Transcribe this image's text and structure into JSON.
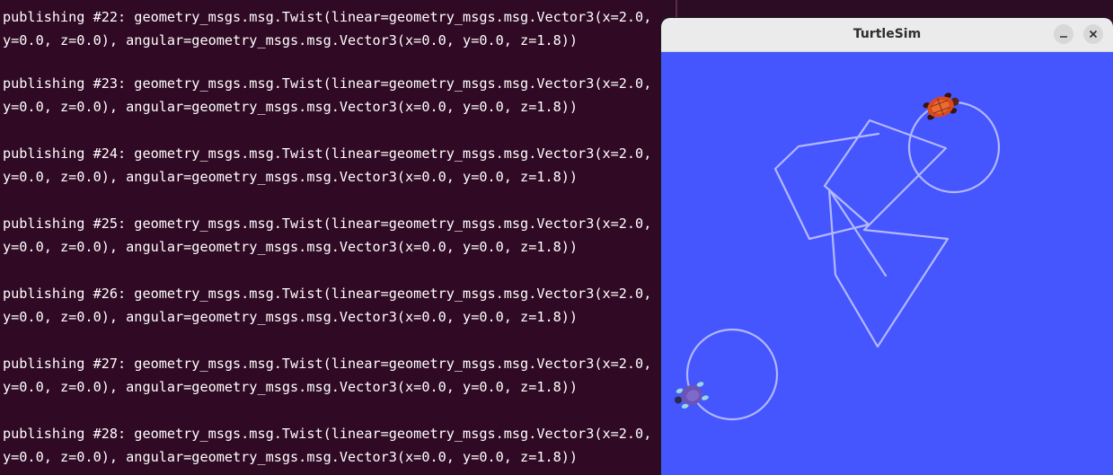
{
  "terminal": {
    "entries": [
      {
        "line1": "publishing #22: geometry_msgs.msg.Twist(linear=geometry_msgs.msg.Vector3(x=2.0,",
        "line2": "y=0.0, z=0.0), angular=geometry_msgs.msg.Vector3(x=0.0, y=0.0, z=1.8))"
      },
      {
        "line1": "publishing #23: geometry_msgs.msg.Twist(linear=geometry_msgs.msg.Vector3(x=2.0,",
        "line2": "y=0.0, z=0.0), angular=geometry_msgs.msg.Vector3(x=0.0, y=0.0, z=1.8))"
      },
      {
        "line1": "publishing #24: geometry_msgs.msg.Twist(linear=geometry_msgs.msg.Vector3(x=2.0,",
        "line2": "y=0.0, z=0.0), angular=geometry_msgs.msg.Vector3(x=0.0, y=0.0, z=1.8))"
      },
      {
        "line1": "publishing #25: geometry_msgs.msg.Twist(linear=geometry_msgs.msg.Vector3(x=2.0,",
        "line2": "y=0.0, z=0.0), angular=geometry_msgs.msg.Vector3(x=0.0, y=0.0, z=1.8))"
      },
      {
        "line1": "publishing #26: geometry_msgs.msg.Twist(linear=geometry_msgs.msg.Vector3(x=2.0,",
        "line2": "y=0.0, z=0.0), angular=geometry_msgs.msg.Vector3(x=0.0, y=0.0, z=1.8))"
      },
      {
        "line1": "publishing #27: geometry_msgs.msg.Twist(linear=geometry_msgs.msg.Vector3(x=2.0,",
        "line2": "y=0.0, z=0.0), angular=geometry_msgs.msg.Vector3(x=0.0, y=0.0, z=1.8))"
      },
      {
        "line1": "publishing #28: geometry_msgs.msg.Twist(linear=geometry_msgs.msg.Vector3(x=2.0,",
        "line2": "y=0.0, z=0.0), angular=geometry_msgs.msg.Vector3(x=0.0, y=0.0, z=1.8))"
      }
    ]
  },
  "turtlesim": {
    "title": "TurtleSim",
    "minimize_icon": "minimize-icon",
    "close_icon": "close-icon",
    "colors": {
      "background": "#4556ff",
      "trail": "#b3b8ff",
      "turtle_orange": "#d94a1e",
      "turtle_purple": "#6a54b8"
    }
  }
}
